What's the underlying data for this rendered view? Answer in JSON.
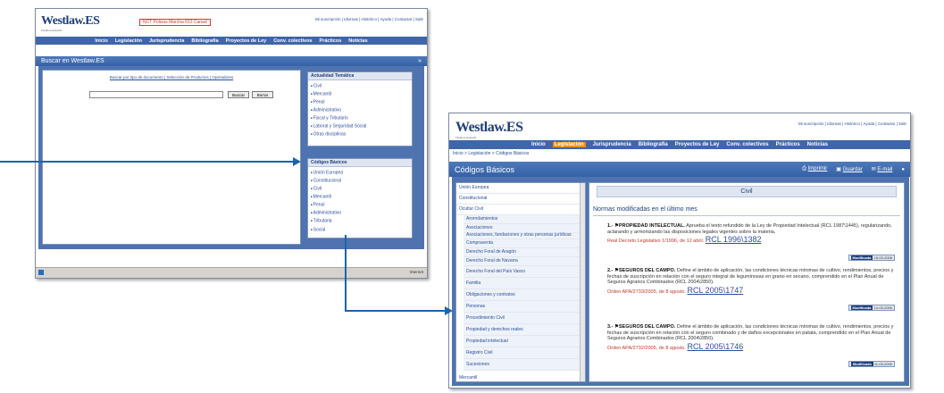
{
  "colors": {
    "nav": "#3f66a8",
    "accent": "#f28c1c",
    "link": "#2a4f9a",
    "arrow": "#1d63ad"
  },
  "win1": {
    "logo": "Westlaw.ES",
    "logo_sub": "Thomson Aranzadi",
    "notice": "NCT Polizas Marcha 013 Canad",
    "toplinks": "Mi suscripción | Idiomas | Histórico | Ayuda | Contactar | Salir",
    "nav": [
      "Inicio",
      "Legislación",
      "Jurisprudencia",
      "Bibliografía",
      "Proyectos de Ley",
      "Conv. colectivos",
      "Prácticos",
      "Noticias"
    ],
    "title": "Buscar en Westlaw.ES",
    "search_links": "Buscar por tipo de documento | Selección de Productos | Operadores",
    "search_placeholder": "",
    "buscar_label": "Buscar",
    "borrar_label": "Borrar",
    "actualidad": {
      "title": "Actualidad Temática",
      "items": [
        "Civil",
        "Mercantil",
        "Penal",
        "Administrativo",
        "Fiscal y Tributario",
        "Laboral y Seguridad Social",
        "Otras disciplinas"
      ]
    },
    "codigos": {
      "title": "Códigos Básicos",
      "items": [
        "Unión Europea",
        "Constitucional",
        "Civil",
        "Mercantil",
        "Penal",
        "Administrativo",
        "Tributaria",
        "Social"
      ]
    },
    "status": "Internet"
  },
  "win2": {
    "logo": "Westlaw.ES",
    "logo_sub": "Thomson Aranzadi",
    "toplinks": "Mi suscripción | Idiomas | Histórico | Ayuda | Contactar | Salir",
    "nav": [
      "Inicio",
      "Legislación",
      "Jurisprudencia",
      "Bibliografía",
      "Proyectos de Ley",
      "Conv. colectivos",
      "Prácticos",
      "Noticias"
    ],
    "breadcrumb": "Inicio > Legislación > Códigos Básicos",
    "title": "Códigos Básicos",
    "tools": [
      "Imprimir",
      "Guardar",
      "E-mail"
    ],
    "tree_top": [
      "Unión Europea",
      "Constitucional",
      "Ocultar Civil"
    ],
    "tree_sub": [
      "Arrendamientos",
      "Asociaciones",
      "Asociaciones, fundaciones y otras personas jurídicas",
      "Compraventa",
      "Derecho Foral de Aragón",
      "Derecho Foral de Navarra",
      "Derecho Foral del País Vasco",
      "Familia",
      "Obligaciones y contratos",
      "Personas",
      "Procedimiento Civil",
      "Propiedad y derechos reales",
      "Propiedad intelectual",
      "Registro Civil",
      "Sucesiones"
    ],
    "tree_bottom": "Mercantil",
    "section": "Civil",
    "subheading": "Normas modificadas en el último mes",
    "items": [
      {
        "num": "1.-",
        "title": "PROPIEDAD INTELECTUAL.",
        "text": "Aprueba el texto refundido de la Ley de Propiedad Intelectual (RCL 1987\\1445), regularizando, aclarando y armonizando las disposiciones legales vigentes sobre la materia.",
        "ref": "Real Decreto Legislativo 1/1996, de 12 abril.",
        "rcl": "RCL 1996\\1382",
        "badge": "Modificada",
        "date": "15-03-2006"
      },
      {
        "num": "2.-",
        "title": "SEGUROS DEL CAMPO.",
        "text": "Define el ámbito de aplicación, las condiciones técnicas mínimas de cultivo, rendimientos, precios y fechas de suscripción en relación con el seguro integral de leguminosas en grano en secano, comprendido en el Plan Anual de Seguros Agrarios Combinados (RCL 2004\\2850).",
        "ref": "Orden APA/2733/2005, de 8 agosto.",
        "rcl": "RCL 2005\\1747",
        "badge": "Modificada",
        "date": "14-03-2006"
      },
      {
        "num": "3.-",
        "title": "SEGUROS DEL CAMPO.",
        "text": "Define el ámbito de aplicación, las condiciones técnicas mínimas de cultivo, rendimientos, precios y fechas de suscripción en relación con el seguro combinado y de daños excepcionales en patata, comprendido en el Plan Anual de Seguros Agrarios Combinados (RCL 2004\\2850).",
        "ref": "Orden APA/2732/2005, de 8 agosto.",
        "rcl": "RCL 2005\\1746",
        "badge": "Modificada",
        "date": "11-03-2006"
      }
    ]
  }
}
